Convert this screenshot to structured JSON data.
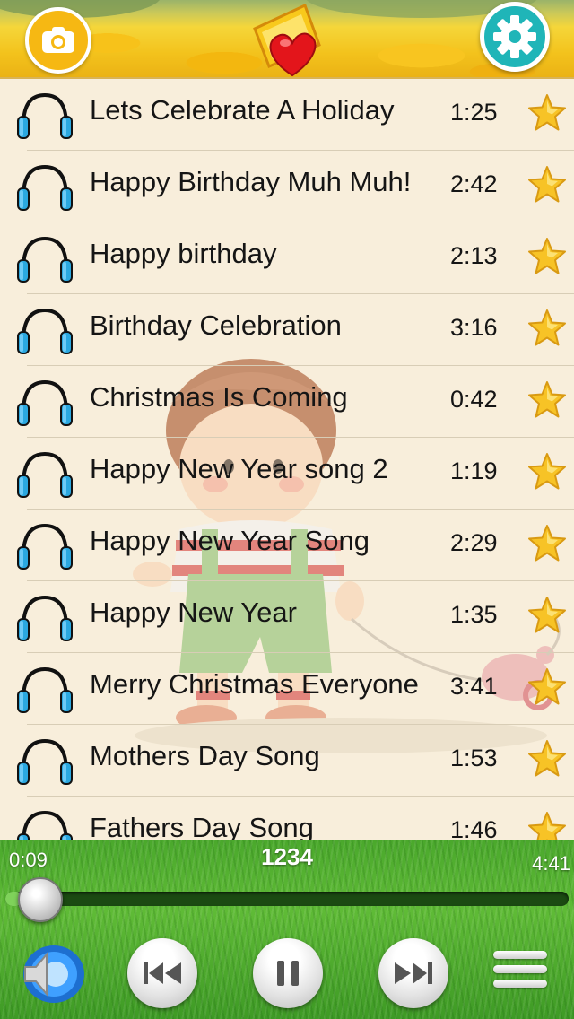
{
  "header": {
    "left_button_icon": "camera-icon",
    "center_icon": "favorites-heart-icon",
    "right_button_icon": "gear-icon"
  },
  "songs": [
    {
      "title": "Lets Celebrate A Holiday",
      "duration": "1:25"
    },
    {
      "title": "Happy Birthday Muh Muh!",
      "duration": "2:42"
    },
    {
      "title": "Happy birthday",
      "duration": "2:13"
    },
    {
      "title": "Birthday Celebration",
      "duration": "3:16"
    },
    {
      "title": "Christmas Is Coming",
      "duration": "0:42"
    },
    {
      "title": "Happy New Year song 2",
      "duration": "1:19"
    },
    {
      "title": "Happy New Year Song",
      "duration": "2:29"
    },
    {
      "title": "Happy New Year",
      "duration": "1:35"
    },
    {
      "title": "Merry Christmas Everyone",
      "duration": "3:41"
    },
    {
      "title": "Mothers Day Song",
      "duration": "1:53"
    },
    {
      "title": "Fathers Day Song",
      "duration": "1:46"
    }
  ],
  "player": {
    "elapsed": "0:09",
    "total": "4:41",
    "now_playing": "1234",
    "progress_fraction": 0.032,
    "buttons": {
      "volume": "speaker-icon",
      "previous": "skip-previous-icon",
      "play_pause": "pause-icon",
      "next": "skip-next-icon",
      "menu": "hamburger-menu-icon"
    }
  },
  "colors": {
    "list_background": "#f8eedb",
    "star": "#f7c326",
    "headphone_cup": "#2ba8e0",
    "settings_button": "#1fb5b8",
    "camera_button": "#f6b813",
    "player_grass": "#4aa82c"
  }
}
